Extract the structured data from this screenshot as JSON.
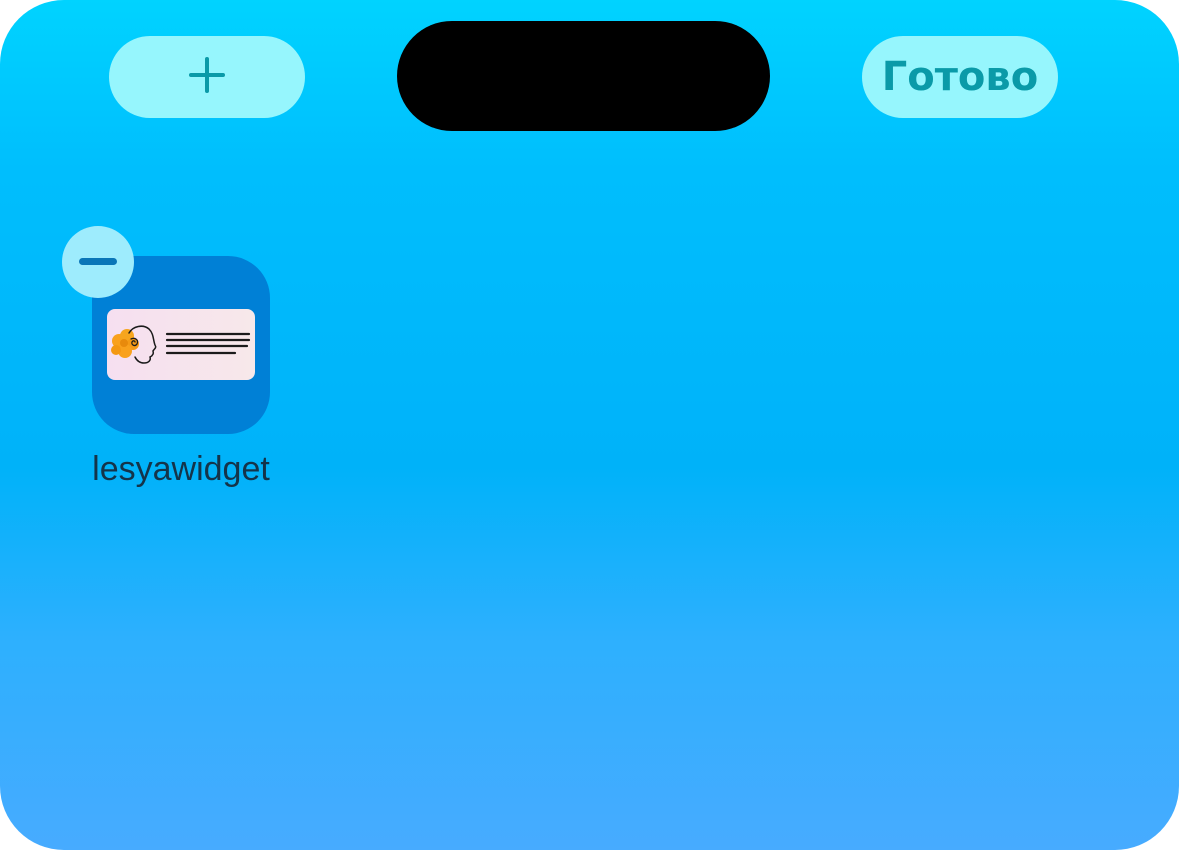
{
  "toolbar": {
    "add_icon": "plus-icon",
    "done_label": "Готово"
  },
  "home_screen": {
    "apps": [
      {
        "label": "lesyawidget",
        "icon": "lesyawidget-app-icon",
        "remove_icon": "minus-icon"
      }
    ]
  },
  "colors": {
    "accent_button_bg": "#96f6fd",
    "accent_button_text": "#0a9aa8",
    "app_icon_bg": "#0080d6",
    "background_top": "#00d3ff",
    "background_bottom": "#47abff"
  }
}
